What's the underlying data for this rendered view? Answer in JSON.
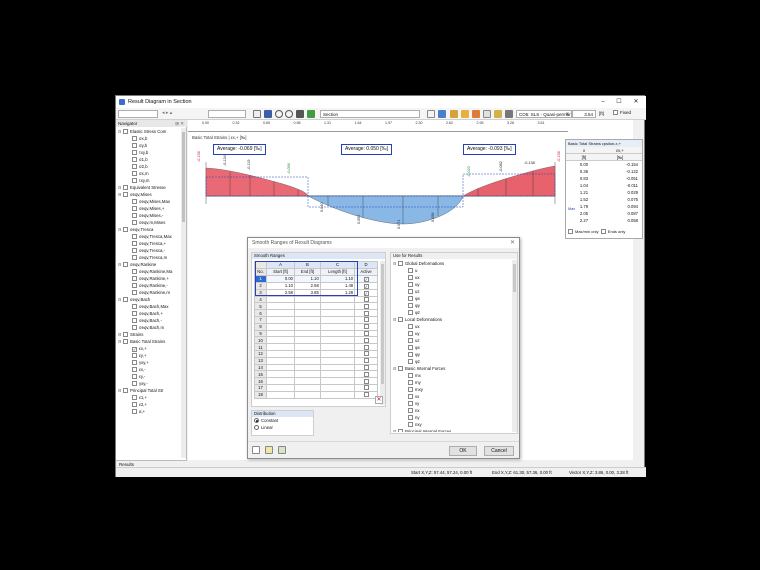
{
  "window": {
    "title": "Result Diagram in Section",
    "minimize": "–",
    "maximize": "☐",
    "close": "✕"
  },
  "toolbar": {
    "section_label": "Section",
    "load_combo": "CO5: SLS - Quasi-perman",
    "x_label": "x:",
    "x_value": "3.54",
    "x_unit": "[ft]",
    "fixed_label": "Fixed"
  },
  "ruler": {
    "ticks": [
      "0.00",
      "0.32",
      "0.65",
      "0.98",
      "1.31",
      "1.64",
      "1.97",
      "2.30",
      "2.62",
      "2.95",
      "3.28",
      "3.61"
    ]
  },
  "diagram": {
    "title": "Basic Total Strains | εx,+ [‰]",
    "averages": [
      "Average: -0.069 [‰]",
      "Average: 0.050 [‰]",
      "Average: -0.093 [‰]"
    ],
    "labels": [
      "-0.156",
      "-0.134",
      "-0.119",
      "-0.056",
      "-0.023",
      "0.040",
      "0.048",
      "0.057",
      "0.069",
      "0.071",
      "0.069",
      "0.059",
      "0.043",
      "-0.020",
      "-0.047",
      "-0.082",
      "-0.120",
      "-0.138",
      "-0.156"
    ],
    "colors": {
      "negative": "#e8626e",
      "positive": "#8ab8e6",
      "accent": "#2540b8"
    }
  },
  "navigator": {
    "header": "Navigator",
    "footer": "Results",
    "items": [
      {
        "label": "Elastic Stress Com",
        "level": 0,
        "group": true
      },
      {
        "label": "σx,b",
        "level": 1
      },
      {
        "label": "σy,b",
        "level": 1
      },
      {
        "label": "τxy,b",
        "level": 1
      },
      {
        "label": "σ1,b",
        "level": 1
      },
      {
        "label": "σ2,b",
        "level": 1
      },
      {
        "label": "σx,m",
        "level": 1
      },
      {
        "label": "τxy,m",
        "level": 1
      },
      {
        "label": "Equivalent Stresse",
        "level": 0,
        "group": true
      },
      {
        "label": "σeqv,Mises",
        "level": 0,
        "group": true
      },
      {
        "label": "σeqv,Mises,Max",
        "level": 1
      },
      {
        "label": "σeqv,Mises,+",
        "level": 1
      },
      {
        "label": "σeqv,Mises,-",
        "level": 1
      },
      {
        "label": "σeqv,m,Mises",
        "level": 1
      },
      {
        "label": "σeqv,Tresca",
        "level": 0,
        "group": true
      },
      {
        "label": "σeqv,Tresca,Max",
        "level": 1
      },
      {
        "label": "σeqv,Tresca,+",
        "level": 1
      },
      {
        "label": "σeqv,Tresca,-",
        "level": 1
      },
      {
        "label": "σeqv,Tresca,m",
        "level": 1
      },
      {
        "label": "σeqv,Rankine",
        "level": 0,
        "group": true
      },
      {
        "label": "σeqv,Rankine,Ma",
        "level": 1
      },
      {
        "label": "σeqv,Rankine,+",
        "level": 1
      },
      {
        "label": "σeqv,Rankine,-",
        "level": 1
      },
      {
        "label": "σeqv,Rankine,m",
        "level": 1
      },
      {
        "label": "σeqv,Bach",
        "level": 0,
        "group": true
      },
      {
        "label": "σeqv,Bach,Max",
        "level": 1
      },
      {
        "label": "σeqv,Bach,+",
        "level": 1
      },
      {
        "label": "σeqv,Bach,-",
        "level": 1
      },
      {
        "label": "σeqv,Bach,m",
        "level": 1
      },
      {
        "label": "Strains",
        "level": 0,
        "group": true
      },
      {
        "label": "Basic Total Strains",
        "level": 0,
        "group": true
      },
      {
        "label": "εx,+",
        "level": 1,
        "checked": true
      },
      {
        "label": "εy,+",
        "level": 1
      },
      {
        "label": "γxy,+",
        "level": 1
      },
      {
        "label": "εx,-",
        "level": 1
      },
      {
        "label": "εy,-",
        "level": 1
      },
      {
        "label": "γxy,-",
        "level": 1
      },
      {
        "label": "Principal Total Str",
        "level": 0,
        "group": true
      },
      {
        "label": "ε1,+",
        "level": 1
      },
      {
        "label": "ε2,+",
        "level": 1
      },
      {
        "label": "α,+",
        "level": 1
      }
    ]
  },
  "results_panel": {
    "title": "Basic Total Strains εpsilon-x,+",
    "col_x": "x",
    "col_x_unit": "[ft]",
    "col_v": "εx,+",
    "col_v_unit": "[‰]",
    "rows": [
      {
        "x": "0.00",
        "v": "-0.154"
      },
      {
        "x": "0.36",
        "v": "-0.122"
      },
      {
        "x": "0.83",
        "v": "-0.051"
      },
      {
        "x": "1.04",
        "v": "-0.011"
      },
      {
        "x": "1.21",
        "v": "0.029"
      },
      {
        "x": "1.52",
        "v": "0.075"
      },
      {
        "x": "1.79",
        "v": "0.094"
      },
      {
        "x": "2.05",
        "v": "0.087"
      },
      {
        "x": "2.27",
        "v": "0.058"
      }
    ],
    "max_label": "Max",
    "max_only": "Max/min only",
    "ends_only": "Ends only"
  },
  "status": {
    "start": "Start X,Y,Z: 57.44, 57.24, 0.00 ft",
    "end": "End X,Y,Z: 61.30, 57.36, 0.00 ft",
    "vector": "Vector X,Y,Z: 3.86, 0.00, 3.28 ft"
  },
  "dialog": {
    "title": "Smooth Ranges of Result Diagrams",
    "group_label": "Smooth Ranges",
    "columns": {
      "no": "No.",
      "a": "A",
      "b": "B",
      "c": "C",
      "d": "D",
      "start": "Start [ft]",
      "end": "End [ft]",
      "length": "Length [ft]",
      "active": "Active"
    },
    "rows": [
      {
        "no": "1",
        "start": "0.00",
        "end": "1.10",
        "length": "1.10",
        "active": true
      },
      {
        "no": "2",
        "start": "1.10",
        "end": "2.58",
        "length": "1.48",
        "active": true
      },
      {
        "no": "3",
        "start": "2.58",
        "end": "3.85",
        "length": "1.28",
        "active": true
      },
      {
        "no": "4"
      },
      {
        "no": "5"
      },
      {
        "no": "6"
      },
      {
        "no": "7"
      },
      {
        "no": "8"
      },
      {
        "no": "9"
      },
      {
        "no": "10"
      },
      {
        "no": "11"
      },
      {
        "no": "12"
      },
      {
        "no": "13"
      },
      {
        "no": "14"
      },
      {
        "no": "15"
      },
      {
        "no": "16"
      },
      {
        "no": "17"
      },
      {
        "no": "18"
      }
    ],
    "use_for_results": "Use for Results",
    "tree": [
      {
        "label": "Global Deformations",
        "level": 0
      },
      {
        "label": "u",
        "level": 1
      },
      {
        "label": "ux",
        "level": 1
      },
      {
        "label": "uy",
        "level": 1
      },
      {
        "label": "uz",
        "level": 1
      },
      {
        "label": "φx",
        "level": 1
      },
      {
        "label": "φy",
        "level": 1
      },
      {
        "label": "φz",
        "level": 1
      },
      {
        "label": "Local Deformations",
        "level": 0
      },
      {
        "label": "ux",
        "level": 1
      },
      {
        "label": "uy",
        "level": 1
      },
      {
        "label": "uz",
        "level": 1
      },
      {
        "label": "φx",
        "level": 1
      },
      {
        "label": "φy",
        "level": 1
      },
      {
        "label": "φz",
        "level": 1
      },
      {
        "label": "Basic Internal Forces",
        "level": 0
      },
      {
        "label": "mx",
        "level": 1
      },
      {
        "label": "my",
        "level": 1
      },
      {
        "label": "mxy",
        "level": 1
      },
      {
        "label": "vx",
        "level": 1
      },
      {
        "label": "vy",
        "level": 1
      },
      {
        "label": "nx",
        "level": 1
      },
      {
        "label": "ny",
        "level": 1
      },
      {
        "label": "nxy",
        "level": 1
      },
      {
        "label": "Principal Internal Forces",
        "level": 0
      }
    ],
    "distribution_label": "Distribution",
    "constant": "Constant",
    "linear": "Linear",
    "ok": "OK",
    "cancel": "Cancel"
  }
}
